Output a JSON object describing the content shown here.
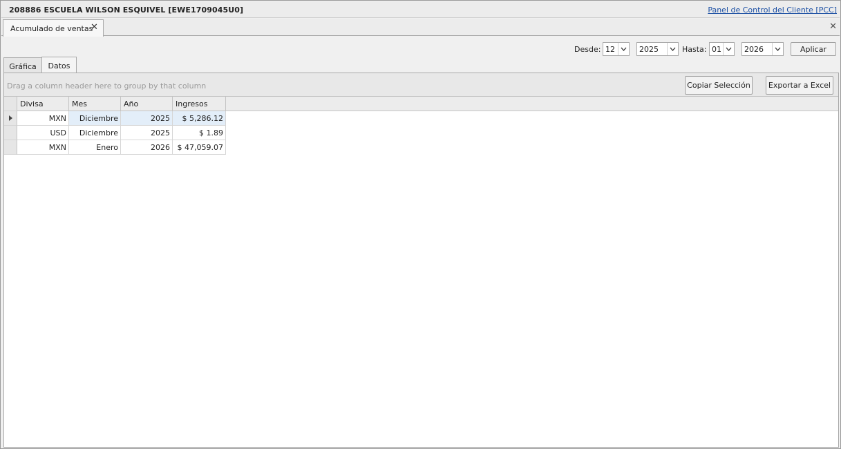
{
  "window": {
    "title": "208886 ESCUELA WILSON ESQUIVEL [EWE1709045U0]",
    "link": "Panel de Control del Cliente [PCC]"
  },
  "doc_tab": {
    "label": "Acumulado de ventas",
    "close": "✕"
  },
  "panel_close": "✕",
  "filters": {
    "desde_label": "Desde:",
    "desde_month": "12",
    "desde_year": "2025",
    "hasta_label": "Hasta:",
    "hasta_month": "01",
    "hasta_year": "2026",
    "apply": "Aplicar"
  },
  "subtabs": [
    {
      "label": "Gráfica",
      "active": false
    },
    {
      "label": "Datos",
      "active": true
    }
  ],
  "grid": {
    "group_hint": "Drag a column header here to group by that column",
    "copy_button": "Copiar Selección",
    "export_button": "Exportar a Excel",
    "columns": [
      "Divisa",
      "Mes",
      "Año",
      "Ingresos"
    ],
    "rows": [
      [
        "MXN",
        "Diciembre",
        "2025",
        "$ 5,286.12"
      ],
      [
        "USD",
        "Diciembre",
        "2025",
        "$ 1.89"
      ],
      [
        "MXN",
        "Enero",
        "2026",
        "$ 47,059.07"
      ]
    ]
  },
  "colors": {
    "link": "#1b4fa3",
    "selected_row": "#e3eef9"
  }
}
